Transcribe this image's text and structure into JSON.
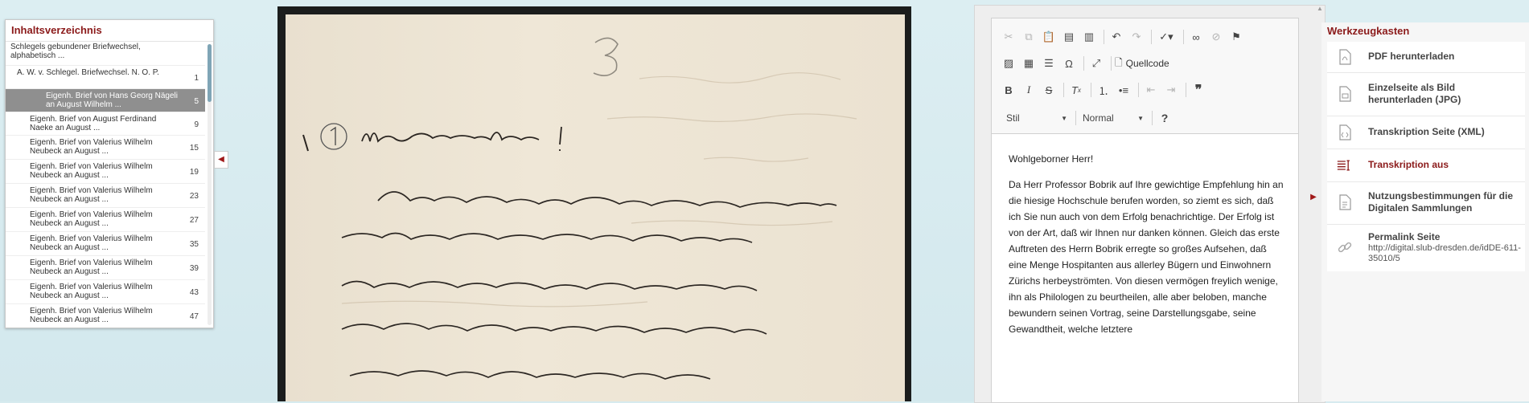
{
  "toc": {
    "title": "Inhaltsverzeichnis",
    "items": [
      {
        "text": "Schlegels gebundener Briefwechsel, alphabetisch ...",
        "page": ""
      },
      {
        "text": "A. W. v. Schlegel. Briefwechsel. N. O. P.",
        "page": "1"
      },
      {
        "text": "Eigenh. Brief von Hans Georg Nägeli an August Wilhelm ...",
        "page": "5"
      },
      {
        "text": "Eigenh. Brief von August Ferdinand Naeke an August ...",
        "page": "9"
      },
      {
        "text": "Eigenh. Brief von Valerius Wilhelm Neubeck an August ...",
        "page": "15"
      },
      {
        "text": "Eigenh. Brief von Valerius Wilhelm Neubeck an August ...",
        "page": "19"
      },
      {
        "text": "Eigenh. Brief von Valerius Wilhelm Neubeck an August ...",
        "page": "23"
      },
      {
        "text": "Eigenh. Brief von Valerius Wilhelm Neubeck an August ...",
        "page": "27"
      },
      {
        "text": "Eigenh. Brief von Valerius Wilhelm Neubeck an August ...",
        "page": "35"
      },
      {
        "text": "Eigenh. Brief von Valerius Wilhelm Neubeck an August ...",
        "page": "39"
      },
      {
        "text": "Eigenh. Brief von Valerius Wilhelm Neubeck an August ...",
        "page": "43"
      },
      {
        "text": "Eigenh. Brief von Valerius Wilhelm Neubeck an August ...",
        "page": "47"
      }
    ]
  },
  "editor": {
    "source_label": "Quellcode",
    "style_label": "Stil",
    "format_label": "Normal",
    "help_label": "?",
    "paragraphs": [
      "Wohlgeborner Herr!",
      "Da Herr Professor Bobrik auf Ihre gewichtige Empfehlung hin an die hiesige Hochschule berufen worden, so ziemt es sich, daß ich Sie nun auch von dem Erfolg benachrichtige. Der Erfolg ist von der Art, daß wir Ihnen nur danken können. Gleich das erste Auftreten des Herrn Bobrik erregte so großes Aufsehen, daß eine Menge Hospitanten aus allerley Bügern und Einwohnern Zürichs herbeyströmten. Von diesen vermögen freylich wenige, ihn als Philologen zu beurtheilen, alle aber beloben, manche bewundern seinen Vortrag, seine Darstellungsgabe, seine Gewandtheit, welche letztere"
    ]
  },
  "toolbox": {
    "title": "Werkzeugkasten",
    "items": [
      {
        "label": "PDF herunterladen",
        "sub": ""
      },
      {
        "label": "Einzelseite als Bild herunterladen (JPG)",
        "sub": ""
      },
      {
        "label": "Transkription Seite (XML)",
        "sub": ""
      },
      {
        "label": "Transkription aus",
        "sub": ""
      },
      {
        "label": "Nutzungsbestimmungen für die Digitalen Sammlungen",
        "sub": ""
      },
      {
        "label": "Permalink Seite",
        "sub": "http://digital.slub-dresden.de/idDE-611-35010/5"
      }
    ]
  },
  "colors": {
    "accent": "#8b1a1a",
    "active_row": "#8f8f8f"
  }
}
